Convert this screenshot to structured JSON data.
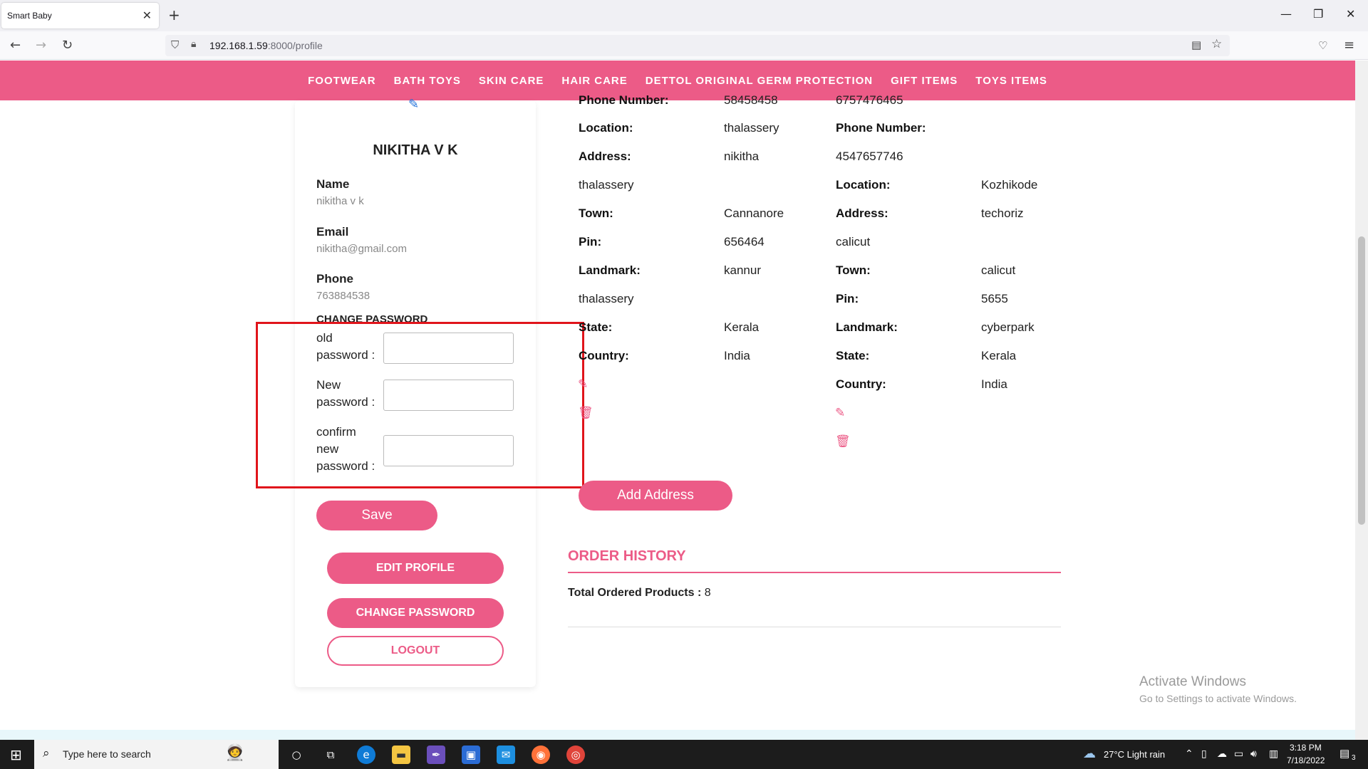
{
  "browser": {
    "tab_title": "Smart Baby",
    "url_host": "192.168.1.59",
    "url_path": ":8000/profile"
  },
  "menu": [
    "FOOTWEAR",
    "BATH TOYS",
    "SKIN CARE",
    "HAIR CARE",
    "DETTOL ORIGINAL GERM PROTECTION",
    "GIFT ITEMS",
    "TOYS ITEMS"
  ],
  "profile": {
    "display_name": "NIKITHA V K",
    "name_label": "Name",
    "name_value": "nikitha v k",
    "email_label": "Email",
    "email_value": "nikitha@gmail.com",
    "phone_label": "Phone",
    "phone_value": "763884538",
    "change_password_heading": "CHANGE PASSWORD",
    "old_password_label": [
      "old",
      "password :"
    ],
    "new_password_label": [
      "New",
      "password :"
    ],
    "confirm_password_label": [
      "confirm",
      "new",
      "password :"
    ],
    "save_label": "Save",
    "edit_profile_label": "EDIT PROFILE",
    "change_password_label": "CHANGE PASSWORD",
    "logout_label": "LOGOUT"
  },
  "address1": {
    "phone_label": "Phone Number:",
    "phone_value": "58458458",
    "location_label": "Location:",
    "location_value": "thalassery",
    "address_label": "Address:",
    "address_value": "nikitha",
    "address_line2": "thalassery",
    "town_label": "Town:",
    "town_value": "Cannanore",
    "pin_label": "Pin:",
    "pin_value": "656464",
    "landmark_label": "Landmark:",
    "landmark_value": "kannur",
    "landmark_line2": "thalassery",
    "state_label": "State:",
    "state_value": "Kerala",
    "country_label": "Country:",
    "country_value": "India"
  },
  "address2": {
    "phone_top_value": "6757476465",
    "phone_label": "Phone Number:",
    "phone_value": "4547657746",
    "location_label": "Location:",
    "location_value": "Kozhikode",
    "address_label": "Address:",
    "address_value": "techoriz",
    "address_line2": "calicut",
    "town_label": "Town:",
    "town_value": "calicut",
    "pin_label": "Pin:",
    "pin_value": "5655",
    "landmark_label": "Landmark:",
    "landmark_value": "cyberpark",
    "state_label": "State:",
    "state_value": "Kerala",
    "country_label": "Country:",
    "country_value": "India"
  },
  "add_address_label": "Add Address",
  "order_history": {
    "title": "ORDER HISTORY",
    "total_label": "Total Ordered Products :",
    "total_value": "8"
  },
  "watermark": {
    "line1": "Activate Windows",
    "line2": "Go to Settings to activate Windows."
  },
  "taskbar": {
    "search_placeholder": "Type here to search",
    "weather": "27°C  Light rain",
    "time": "3:18 PM",
    "date": "7/18/2022",
    "notification_count": "3"
  },
  "colors": {
    "brand_pink": "#ec5b87",
    "highlight_red": "#e0141b"
  }
}
